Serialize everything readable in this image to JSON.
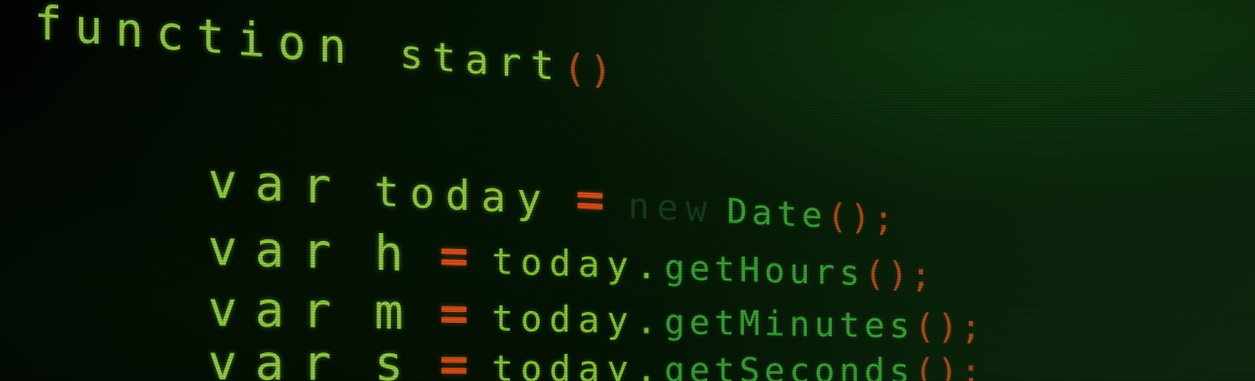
{
  "code": {
    "line1": {
      "keyword": "function",
      "name": "start",
      "parens": "()"
    },
    "line2": {
      "keyword": "var",
      "name": "today",
      "operator": "=",
      "new_keyword": "new",
      "call": "Date",
      "parens": "();"
    },
    "line3": {
      "keyword": "var",
      "name": "h",
      "operator": "=",
      "object": "today.",
      "call": "getHours",
      "parens": "();"
    },
    "line4": {
      "keyword": "var",
      "name": "m",
      "operator": "=",
      "object": "today.",
      "call": "getMinutes",
      "parens": "();"
    },
    "line5": {
      "keyword": "var",
      "name": "s",
      "operator": "=",
      "object": "today.",
      "call": "getSeconds",
      "parens": "();"
    }
  },
  "colors": {
    "keyword": "#9ad64a",
    "function_call": "#3fa83a",
    "operator": "#e0541a",
    "punctuation": "#b3501e",
    "background": "#020802"
  }
}
